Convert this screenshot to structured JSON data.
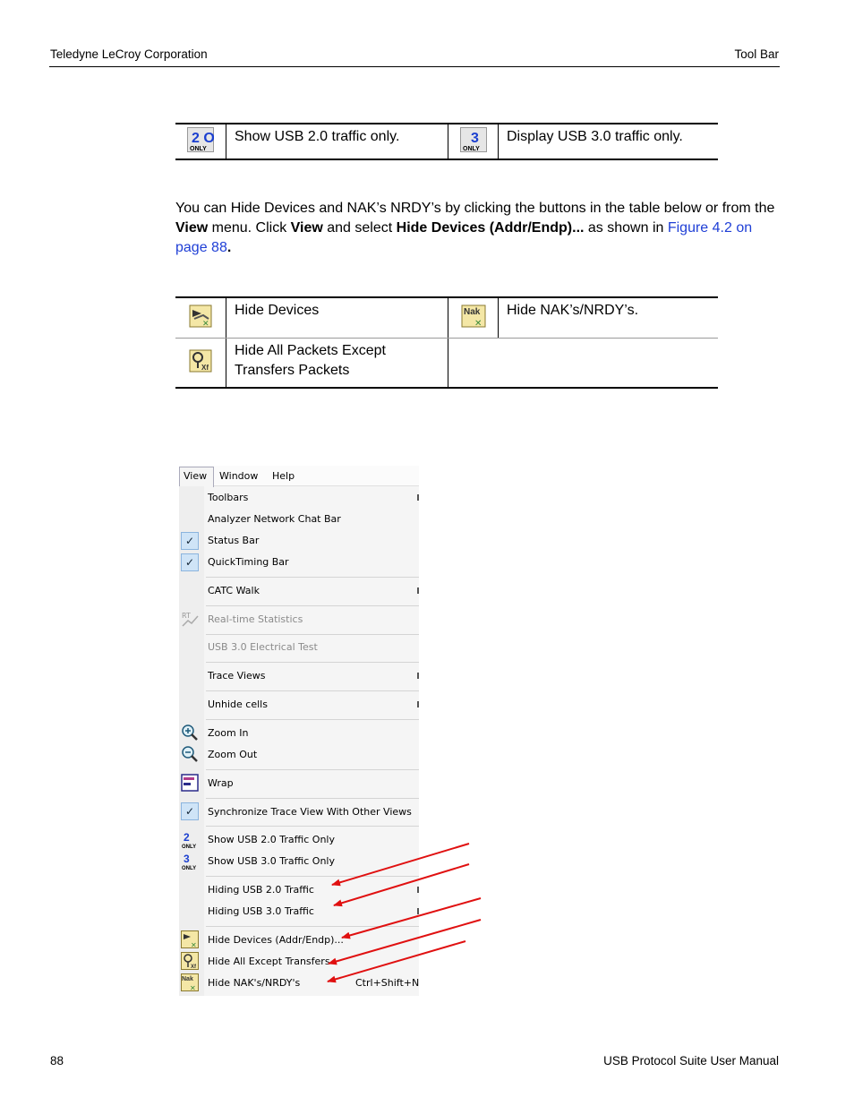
{
  "header": {
    "left": "Teledyne LeCroy Corporation",
    "right": "Tool Bar"
  },
  "table1": {
    "cell1": "Show USB 2.0 traffic only.",
    "cell2": "Display USB 3.0 traffic only."
  },
  "paragraph": {
    "p1": "You can Hide Devices and NAK’s NRDY’s by clicking the buttons in the table below or from the ",
    "b1": "View",
    "p2": " menu. Click ",
    "b2": "View",
    "p3": " and select ",
    "b3": "Hide Devices (Addr/Endp)...",
    "p4": " as shown in ",
    "link": "Figure 4.2 on page 88",
    "p5": "."
  },
  "table2": {
    "r1c1": "Hide Devices",
    "r1c2": "Hide NAK’s/NRDY’s.",
    "r2c1a": "Hide All Packets Except",
    "r2c1b": "Transfers Packets"
  },
  "menu": {
    "bar": [
      "View",
      "Window",
      "Help"
    ],
    "items": {
      "toolbars": "Toolbars",
      "chat": "Analyzer Network Chat Bar",
      "status": "Status Bar",
      "quicktiming": "QuickTiming Bar",
      "catc": "CATC Walk",
      "rts": "Real-time Statistics",
      "electrical": "USB 3.0 Electrical Test",
      "traceviews": "Trace Views",
      "unhide": "Unhide cells",
      "zoomin": "Zoom In",
      "zoomout": "Zoom Out",
      "wrap": "Wrap",
      "sync": "Synchronize Trace View With Other Views",
      "usb2": "Show USB 2.0 Traffic Only",
      "usb3": "Show USB 3.0 Traffic Only",
      "hide2": "Hiding USB 2.0 Traffic",
      "hide3": "Hiding USB 3.0 Traffic",
      "hidedev": "Hide Devices (Addr/Endp)...",
      "hideexcept": "Hide All Except Transfers",
      "hidenak": "Hide NAK's/NRDY's",
      "hidenak_shortcut": "Ctrl+Shift+N"
    },
    "icons": {
      "usb2": "2 ONLY",
      "usb3": "3 ONLY",
      "nak": "Nak",
      "rt": "RT"
    }
  },
  "colors": {
    "arrow": "#e01010",
    "link": "#1f3fd6",
    "check_bg": "#cfe4f7"
  },
  "footer": {
    "page": "88",
    "title": "USB Protocol Suite User Manual"
  }
}
